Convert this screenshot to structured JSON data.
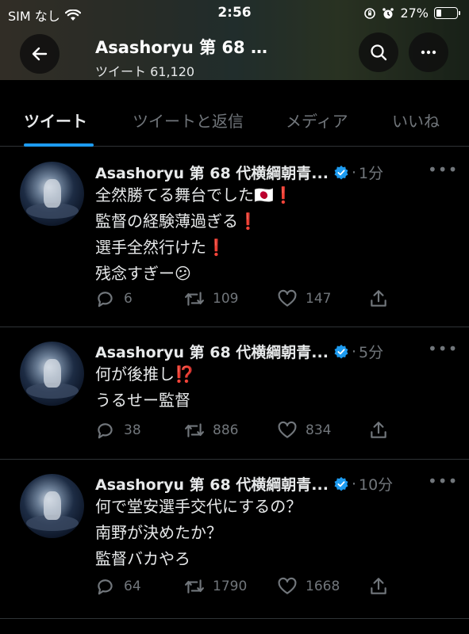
{
  "status_bar": {
    "carrier": "SIM なし",
    "time": "2:56",
    "battery": "27%",
    "battery_level": 0.27
  },
  "header": {
    "title": "Asashoryu 第 68 …",
    "subtitle": "ツイート 61,120"
  },
  "tabs": [
    {
      "label": "ツイート",
      "active": true
    },
    {
      "label": "ツイートと返信",
      "active": false
    },
    {
      "label": "メディア",
      "active": false
    },
    {
      "label": "いいね",
      "active": false
    }
  ],
  "tweets": [
    {
      "author": "Asashoryu 第 68 代横綱朝青...",
      "time_ago": "1分",
      "lines": [
        "全然勝てる舞台でした🇯🇵❗",
        "監督の経験薄過ぎる❗",
        "選手全然行けた❗",
        "残念すぎー😕"
      ],
      "replies": "6",
      "retweets": "109",
      "likes": "147"
    },
    {
      "author": "Asashoryu 第 68 代横綱朝青...",
      "time_ago": "5分",
      "lines": [
        "何が後推し⁉️",
        "うるせー監督"
      ],
      "replies": "38",
      "retweets": "886",
      "likes": "834"
    },
    {
      "author": "Asashoryu 第 68 代横綱朝青...",
      "time_ago": "10分",
      "lines": [
        "何で堂安選手交代にするの？",
        "南野が決めたか？",
        "監督バカやろ"
      ],
      "replies": "64",
      "retweets": "1790",
      "likes": "1668"
    }
  ],
  "colors": {
    "accent": "#1d9bf0",
    "muted": "#71767b",
    "text": "#e7e9ea",
    "divider": "#2f3336"
  }
}
